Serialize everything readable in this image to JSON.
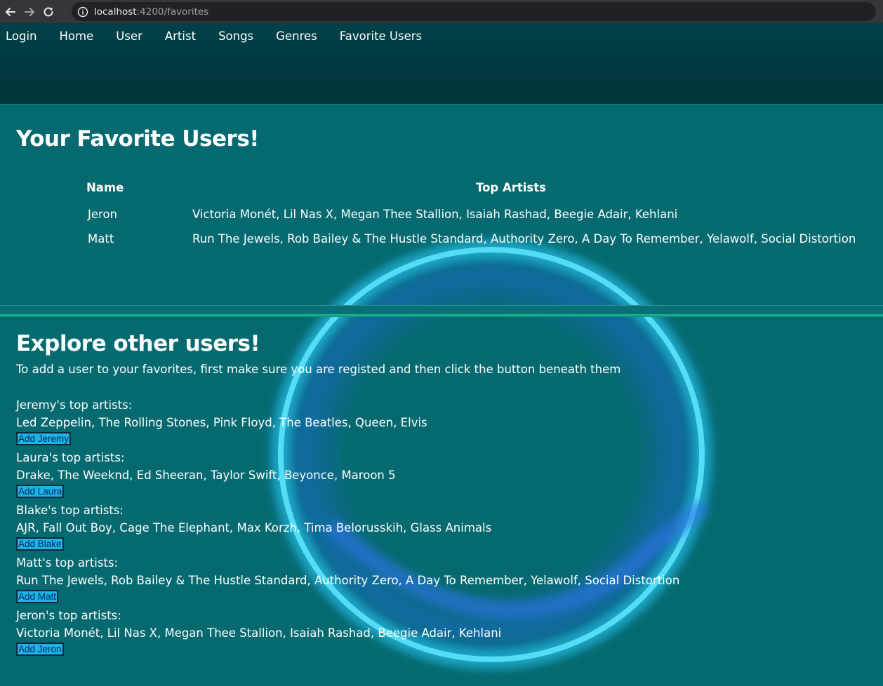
{
  "browser": {
    "url_host": "localhost",
    "url_path": ":4200/favorites"
  },
  "nav": [
    "Login",
    "Home",
    "User",
    "Artist",
    "Songs",
    "Genres",
    "Favorite Users"
  ],
  "favorites": {
    "title": "Your Favorite Users!",
    "columns": {
      "name": "Name",
      "artists": "Top Artists"
    },
    "rows": [
      {
        "name": "Jeron",
        "artists": "Victoria Monét, Lil Nas X, Megan Thee Stallion, Isaiah Rashad, Beegie Adair, Kehlani"
      },
      {
        "name": "Matt",
        "artists": "Run The Jewels, Rob Bailey & The Hustle Standard, Authority Zero, A Day To Remember, Yelawolf, Social Distortion"
      }
    ]
  },
  "explore": {
    "title": "Explore other users!",
    "subtitle": "To add a user to your favorites, first make sure you are registed and then click the button beneath them",
    "users": [
      {
        "heading": "Jeremy's top artists:",
        "artists": "Led Zeppelin, The Rolling Stones, Pink Floyd, The Beatles, Queen, Elvis",
        "button": "Add Jeremy"
      },
      {
        "heading": "Laura's top artists:",
        "artists": "Drake, The Weeknd, Ed Sheeran, Taylor Swift, Beyonce, Maroon 5",
        "button": "Add Laura"
      },
      {
        "heading": "Blake's top artists:",
        "artists": "AJR, Fall Out Boy, Cage The Elephant, Max Korzh, Tima Belorusskih, Glass Animals",
        "button": "Add Blake"
      },
      {
        "heading": "Matt's top artists:",
        "artists": "Run The Jewels, Rob Bailey & The Hustle Standard, Authority Zero, A Day To Remember, Yelawolf, Social Distortion",
        "button": "Add Matt"
      },
      {
        "heading": "Jeron's top artists:",
        "artists": "Victoria Monét, Lil Nas X, Megan Thee Stallion, Isaiah Rashad, Beegie Adair, Kehlani",
        "button": "Add Jeron"
      }
    ]
  },
  "colors": {
    "page_bg": "#056a70",
    "navbar_bg": "#00343a",
    "button_bg": "#1eb2ea",
    "portal_glow": "#29d3f5"
  },
  "icons": [
    "back-arrow-icon",
    "forward-arrow-icon",
    "reload-icon",
    "info-icon",
    "portal-ring"
  ]
}
